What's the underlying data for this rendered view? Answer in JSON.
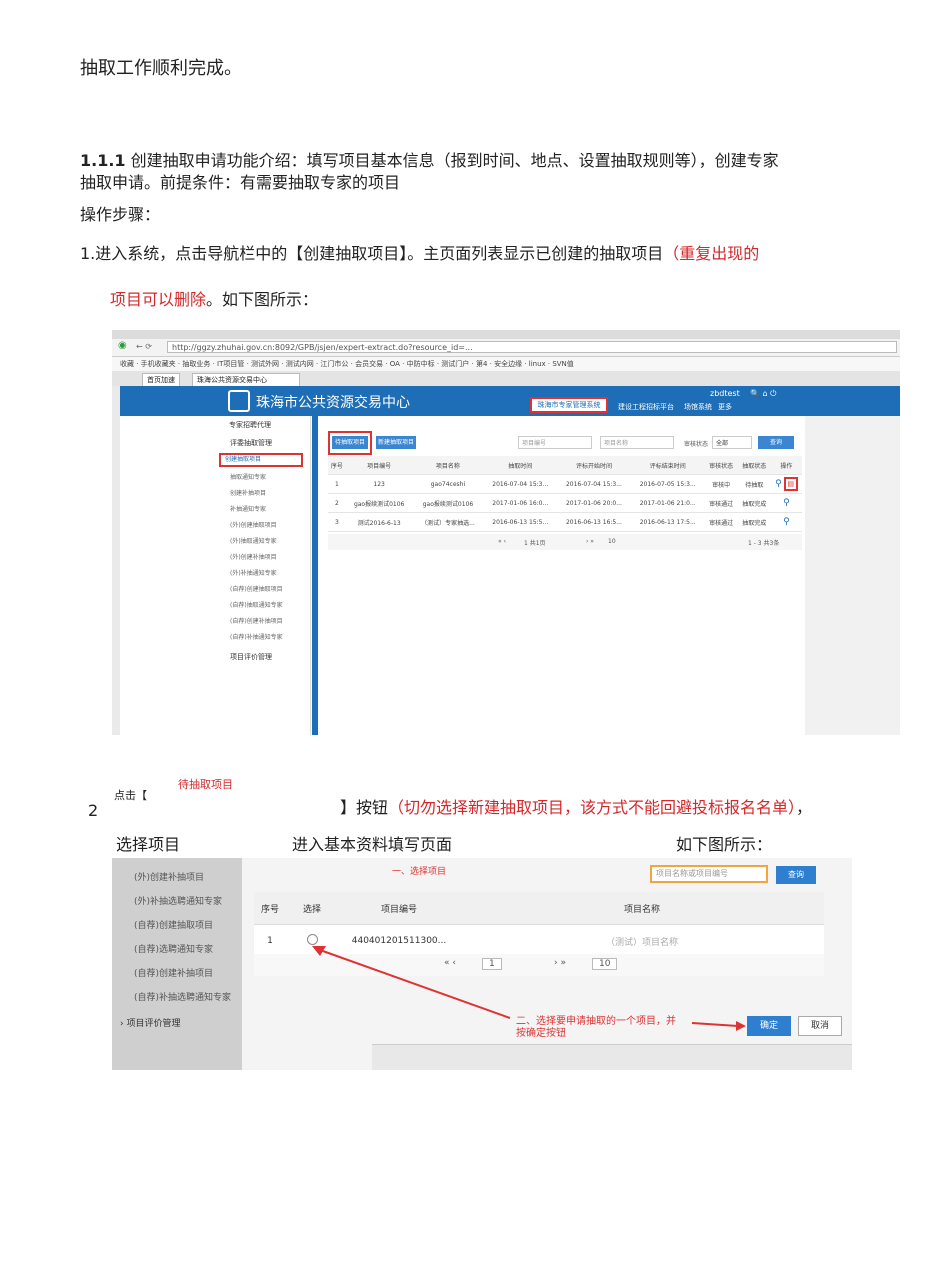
{
  "doc": {
    "line1": "抽取工作顺利完成。",
    "sec_num": "1.1.1",
    "sec_line1": "创建抽取申请功能介绍：填写项目基本信息（报到时间、地点、设置抽取规则等），创建专家",
    "sec_line2": "抽取申请。前提条件：有需要抽取专家的项目",
    "steps_label": "操作步骤：",
    "step1_a": "1.进入系统，点击导航栏中的【创建抽取项目】。主页面列表显示已创建的抽取项目",
    "step1_red1": "（重复出现的",
    "step1_red2": "项目可以删除",
    "step1_b": "。如下图所示：",
    "step2_num": "2",
    "step2_click": "点击【",
    "step2_btn": "待抽取项目",
    "step2_a": "】按钮",
    "step2_red": "（切勿选择新建抽取项目，该方式不能回避投标报名名单）",
    "step2_b": "，",
    "step2_c1": "选择项目",
    "step2_c2": "进入基本资料填写页面",
    "step2_c3": "如下图所示："
  },
  "shot1": {
    "url": "http://ggzy.zhuhai.gov.cn:8092/GPB/jsjen/expert-extract.do?resource_id=...",
    "favorites": "收藏 · 手机收藏夹 · 抽取业务 · IT项目管 · 测试外网 · 测试内网 · 江门市公 · 会员交易 · OA · 中防中标 · 测试门户 · 第4 · 安全边缘 · linux · SVN值",
    "tab1": "首页加速",
    "tab2": "珠海公共资源交易中心",
    "brand": "珠海市公共资源交易中心",
    "nav": [
      "珠海市专家管理系统",
      "建设工程招标平台",
      "场馆系统",
      "更多"
    ],
    "user": "zbdtest",
    "crumb": "专家招聘代理",
    "sidebar_group": "评委抽取管理",
    "sidebar_items": [
      "创建抽取项目",
      "抽取通知专家",
      "创建补抽项目",
      "补抽通知专家",
      "(外)创建抽取项目",
      "(外)抽取通知专家",
      "(外)创建补抽项目",
      "(外)补抽通知专家",
      "(自荐)创建抽取项目",
      "(自荐)抽取通知专家",
      "(自荐)创建补抽项目",
      "(自荐)补抽通知专家"
    ],
    "sidebar_group2": "项目评价管理",
    "btn1": "待抽取项目",
    "btn2": "新建抽取项目",
    "inp1": "项目编号",
    "inp2": "项目名称",
    "status_label": "审核状态",
    "status_value": "全部",
    "search": "查询",
    "headers": [
      "序号",
      "项目编号",
      "项目名称",
      "抽取时间",
      "评标开始时间",
      "评标结束时间",
      "审核状态",
      "抽取状态",
      "操作"
    ],
    "rows": [
      [
        "1",
        "123",
        "gao74ceshi",
        "2016-07-04 15:3...",
        "2016-07-04 15:3...",
        "2016-07-05 15:3...",
        "审核中",
        "待抽取"
      ],
      [
        "2",
        "gao报续测试0106",
        "gao报续测试0106",
        "2017-01-06 16:0...",
        "2017-01-06 20:0...",
        "2017-01-06 21:0...",
        "审核通过",
        "抽取完成"
      ],
      [
        "3",
        "测试2016-6-13",
        "（测试）专家抽选...",
        "2016-06-13 15:5...",
        "2016-06-13 16:5...",
        "2016-06-13 17:5...",
        "审核通过",
        "抽取完成"
      ]
    ],
    "pager": "1  共1页",
    "page_size": "10",
    "summary": "1 - 3  共3条"
  },
  "shot2": {
    "sidebar_items": [
      "(外)创建补抽项目",
      "(外)补抽选聘通知专家",
      "(自荐)创建抽取项目",
      "(自荐)选聘通知专家",
      "(自荐)创建补抽项目",
      "(自荐)补抽选聘通知专家"
    ],
    "sidebar_group": "项目评价管理",
    "title": "一、选择项目",
    "search_placeholder": "项目名称或项目编号",
    "search": "查询",
    "headers": [
      "序号",
      "选择",
      "项目编号",
      "项目名称"
    ],
    "row": [
      "1",
      "",
      "440401201511300...",
      "（测试）项目名称"
    ],
    "page": "1",
    "page_size": "10",
    "note": "二、选择要申请抽取的一个项目，并按确定按钮",
    "confirm": "确定",
    "cancel": "取消"
  }
}
